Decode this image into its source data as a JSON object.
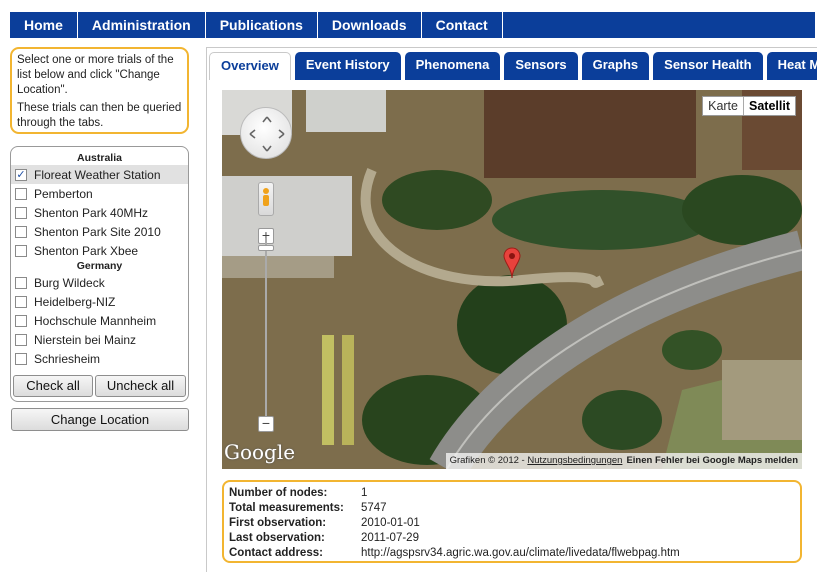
{
  "nav": [
    {
      "label": "Home"
    },
    {
      "label": "Administration"
    },
    {
      "label": "Publications"
    },
    {
      "label": "Downloads"
    },
    {
      "label": "Contact"
    }
  ],
  "info": {
    "line1": "Select one or more trials of the list below and click \"Change Location\".",
    "line2": "These trials can then be queried through the tabs."
  },
  "trials": {
    "groups": [
      {
        "country": "Australia",
        "items": [
          {
            "label": "Floreat Weather Station",
            "checked": true
          },
          {
            "label": "Pemberton",
            "checked": false
          },
          {
            "label": "Shenton Park 40MHz",
            "checked": false
          },
          {
            "label": "Shenton Park Site 2010",
            "checked": false
          },
          {
            "label": "Shenton Park Xbee",
            "checked": false
          }
        ]
      },
      {
        "country": "Germany",
        "items": [
          {
            "label": "Burg Wildeck",
            "checked": false
          },
          {
            "label": "Heidelberg-NIZ",
            "checked": false
          },
          {
            "label": "Hochschule Mannheim",
            "checked": false
          },
          {
            "label": "Nierstein bei Mainz",
            "checked": false
          },
          {
            "label": "Schriesheim",
            "checked": false
          }
        ]
      }
    ],
    "check_all": "Check all",
    "uncheck_all": "Uncheck all",
    "change_location": "Change Location"
  },
  "tabs": [
    {
      "label": "Overview",
      "active": true
    },
    {
      "label": "Event History",
      "active": false
    },
    {
      "label": "Phenomena",
      "active": false
    },
    {
      "label": "Sensors",
      "active": false
    },
    {
      "label": "Graphs",
      "active": false
    },
    {
      "label": "Sensor Health",
      "active": false
    },
    {
      "label": "Heat Map",
      "active": false
    }
  ],
  "map": {
    "type_map": "Karte",
    "type_satellite": "Satellit",
    "logo": "Google",
    "attribution": "Grafiken © 2012 - ",
    "terms": "Nutzungsbedingungen",
    "report": "Einen Fehler bei Google Maps melden"
  },
  "details": {
    "nodes_label": "Number of nodes:",
    "nodes_value": "1",
    "measurements_label": "Total measurements:",
    "measurements_value": "5747",
    "first_label": "First observation:",
    "first_value": "2010-01-01",
    "last_label": "Last observation:",
    "last_value": "2011-07-29",
    "contact_label": "Contact address:",
    "contact_value": "http://agspsrv34.agric.wa.gov.au/climate/livedata/flwebpag.htm"
  },
  "colors": {
    "nav_blue": "#0b3e9a",
    "highlight_border": "#f2b531"
  }
}
